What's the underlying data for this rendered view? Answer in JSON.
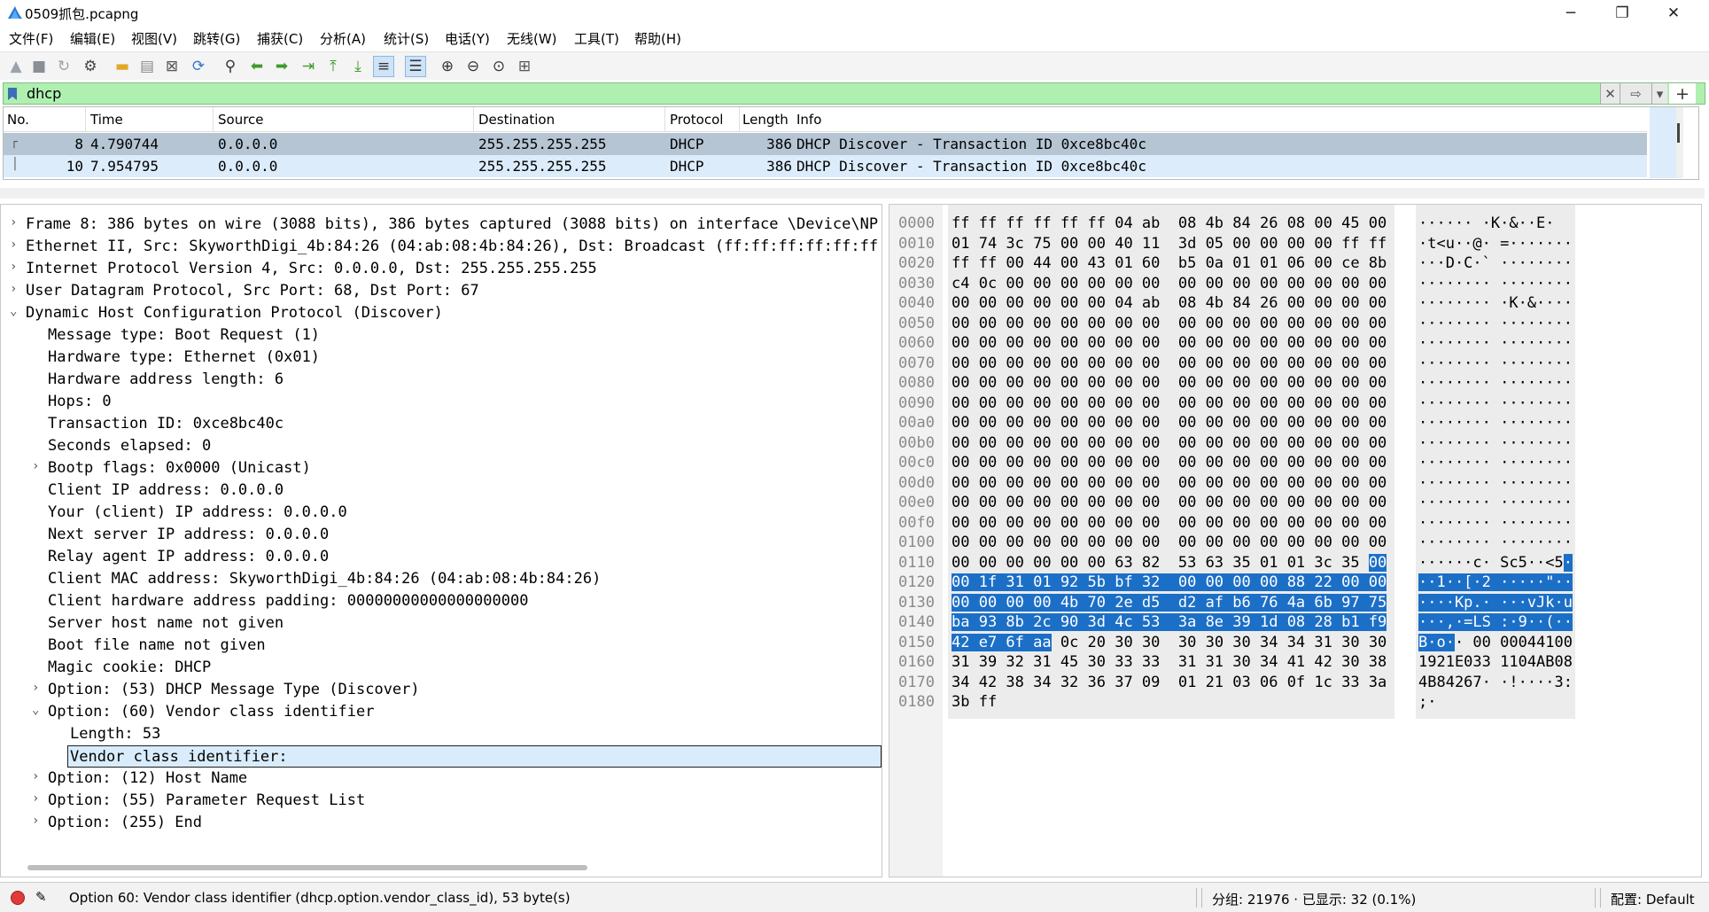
{
  "window": {
    "title": "0509抓包.pcapng",
    "min": "─",
    "max": "❐",
    "close": "✕"
  },
  "menu": [
    "文件(F)",
    "编辑(E)",
    "视图(V)",
    "跳转(G)",
    "捕获(C)",
    "分析(A)",
    "统计(S)",
    "电话(Y)",
    "无线(W)",
    "工具(T)",
    "帮助(H)"
  ],
  "toolbar_icons": [
    "shark-fin-start-icon",
    "stop-icon",
    "restart-icon",
    "options-gear-icon",
    "open-folder-icon",
    "save-file-icon",
    "close-file-icon",
    "reload-icon",
    "find-packet-icon",
    "back-arrow-icon",
    "forward-arrow-icon",
    "go-to-packet-icon",
    "first-packet-icon",
    "last-packet-icon",
    "autoscroll-icon",
    "colorize-icon",
    "zoom-in-icon",
    "zoom-out-icon",
    "zoom-reset-icon",
    "resize-columns-icon"
  ],
  "filter": {
    "value": "dhcp",
    "clear": "✕",
    "apply": "⇨",
    "dropdown": "▾",
    "add": "+"
  },
  "packet_list": {
    "headers": [
      "No.",
      "Time",
      "Source",
      "Destination",
      "Protocol",
      "Length",
      "Info"
    ],
    "rows": [
      {
        "no": "8",
        "time": "4.790744",
        "src": "0.0.0.0",
        "dst": "255.255.255.255",
        "proto": "DHCP",
        "len": "386",
        "info": "DHCP Discover - Transaction ID 0xce8bc40c"
      },
      {
        "no": "10",
        "time": "7.954795",
        "src": "0.0.0.0",
        "dst": "255.255.255.255",
        "proto": "DHCP",
        "len": "386",
        "info": "DHCP Discover - Transaction ID 0xce8bc40c"
      }
    ]
  },
  "detail": [
    {
      "arrow": ">",
      "indent": 0,
      "text": "Frame 8: 386 bytes on wire (3088 bits), 386 bytes captured (3088 bits) on interface \\Device\\NP"
    },
    {
      "arrow": ">",
      "indent": 0,
      "text": "Ethernet II, Src: SkyworthDigi_4b:84:26 (04:ab:08:4b:84:26), Dst: Broadcast (ff:ff:ff:ff:ff:ff"
    },
    {
      "arrow": ">",
      "indent": 0,
      "text": "Internet Protocol Version 4, Src: 0.0.0.0, Dst: 255.255.255.255"
    },
    {
      "arrow": ">",
      "indent": 0,
      "text": "User Datagram Protocol, Src Port: 68, Dst Port: 67"
    },
    {
      "arrow": "v",
      "indent": 0,
      "text": "Dynamic Host Configuration Protocol (Discover)"
    },
    {
      "arrow": "",
      "indent": 1,
      "text": "Message type: Boot Request (1)"
    },
    {
      "arrow": "",
      "indent": 1,
      "text": "Hardware type: Ethernet (0x01)"
    },
    {
      "arrow": "",
      "indent": 1,
      "text": "Hardware address length: 6"
    },
    {
      "arrow": "",
      "indent": 1,
      "text": "Hops: 0"
    },
    {
      "arrow": "",
      "indent": 1,
      "text": "Transaction ID: 0xce8bc40c"
    },
    {
      "arrow": "",
      "indent": 1,
      "text": "Seconds elapsed: 0"
    },
    {
      "arrow": ">",
      "indent": 1,
      "text": "Bootp flags: 0x0000 (Unicast)"
    },
    {
      "arrow": "",
      "indent": 1,
      "text": "Client IP address: 0.0.0.0"
    },
    {
      "arrow": "",
      "indent": 1,
      "text": "Your (client) IP address: 0.0.0.0"
    },
    {
      "arrow": "",
      "indent": 1,
      "text": "Next server IP address: 0.0.0.0"
    },
    {
      "arrow": "",
      "indent": 1,
      "text": "Relay agent IP address: 0.0.0.0"
    },
    {
      "arrow": "",
      "indent": 1,
      "text": "Client MAC address: SkyworthDigi_4b:84:26 (04:ab:08:4b:84:26)"
    },
    {
      "arrow": "",
      "indent": 1,
      "text": "Client hardware address padding: 00000000000000000000"
    },
    {
      "arrow": "",
      "indent": 1,
      "text": "Server host name not given"
    },
    {
      "arrow": "",
      "indent": 1,
      "text": "Boot file name not given"
    },
    {
      "arrow": "",
      "indent": 1,
      "text": "Magic cookie: DHCP"
    },
    {
      "arrow": ">",
      "indent": 1,
      "text": "Option: (53) DHCP Message Type (Discover)"
    },
    {
      "arrow": "v",
      "indent": 1,
      "text": "Option: (60) Vendor class identifier"
    },
    {
      "arrow": "",
      "indent": 2,
      "text": "Length: 53"
    },
    {
      "arrow": "",
      "indent": 2,
      "text": "Vendor class identifier: ",
      "selected": true
    },
    {
      "arrow": ">",
      "indent": 1,
      "text": "Option: (12) Host Name"
    },
    {
      "arrow": ">",
      "indent": 1,
      "text": "Option: (55) Parameter Request List"
    },
    {
      "arrow": ">",
      "indent": 1,
      "text": "Option: (255) End"
    }
  ],
  "bytes": [
    {
      "off": "0000",
      "hex": "ff ff ff ff ff ff 04 ab  08 4b 84 26 08 00 45 00",
      "asc": "······ ·K·&··E·"
    },
    {
      "off": "0010",
      "hex": "01 74 3c 75 00 00 40 11  3d 05 00 00 00 00 ff ff",
      "asc": "·t<u··@· =·······"
    },
    {
      "off": "0020",
      "hex": "ff ff 00 44 00 43 01 60  b5 0a 01 01 06 00 ce 8b",
      "asc": "···D·C·` ········"
    },
    {
      "off": "0030",
      "hex": "c4 0c 00 00 00 00 00 00  00 00 00 00 00 00 00 00",
      "asc": "········ ········"
    },
    {
      "off": "0040",
      "hex": "00 00 00 00 00 00 04 ab  08 4b 84 26 00 00 00 00",
      "asc": "········ ·K·&····"
    },
    {
      "off": "0050",
      "hex": "00 00 00 00 00 00 00 00  00 00 00 00 00 00 00 00",
      "asc": "········ ········"
    },
    {
      "off": "0060",
      "hex": "00 00 00 00 00 00 00 00  00 00 00 00 00 00 00 00",
      "asc": "········ ········"
    },
    {
      "off": "0070",
      "hex": "00 00 00 00 00 00 00 00  00 00 00 00 00 00 00 00",
      "asc": "········ ········"
    },
    {
      "off": "0080",
      "hex": "00 00 00 00 00 00 00 00  00 00 00 00 00 00 00 00",
      "asc": "········ ········"
    },
    {
      "off": "0090",
      "hex": "00 00 00 00 00 00 00 00  00 00 00 00 00 00 00 00",
      "asc": "········ ········"
    },
    {
      "off": "00a0",
      "hex": "00 00 00 00 00 00 00 00  00 00 00 00 00 00 00 00",
      "asc": "········ ········"
    },
    {
      "off": "00b0",
      "hex": "00 00 00 00 00 00 00 00  00 00 00 00 00 00 00 00",
      "asc": "········ ········"
    },
    {
      "off": "00c0",
      "hex": "00 00 00 00 00 00 00 00  00 00 00 00 00 00 00 00",
      "asc": "········ ········"
    },
    {
      "off": "00d0",
      "hex": "00 00 00 00 00 00 00 00  00 00 00 00 00 00 00 00",
      "asc": "········ ········"
    },
    {
      "off": "00e0",
      "hex": "00 00 00 00 00 00 00 00  00 00 00 00 00 00 00 00",
      "asc": "········ ········"
    },
    {
      "off": "00f0",
      "hex": "00 00 00 00 00 00 00 00  00 00 00 00 00 00 00 00",
      "asc": "········ ········"
    },
    {
      "off": "0100",
      "hex": "00 00 00 00 00 00 00 00  00 00 00 00 00 00 00 00",
      "asc": "········ ········"
    },
    {
      "off": "0110",
      "hex": "00 00 00 00 00 00 63 82  53 63 35 01 01 3c 35 ",
      "hexhl": "00",
      "asc": "······c· Sc5··<5",
      "aschl": "·"
    },
    {
      "off": "0120",
      "hexhl": "00 1f 31 01 92 5b bf 32  00 00 00 00 88 22 00 00",
      "aschl": "··1··[·2 ·····\"··"
    },
    {
      "off": "0130",
      "hexhl": "00 00 00 00 4b 70 2e d5  d2 af b6 76 4a 6b 97 75",
      "aschl": "····Kp.· ···vJk·u"
    },
    {
      "off": "0140",
      "hexhl": "ba 93 8b 2c 90 3d 4c 53  3a 8e 39 1d 08 28 b1 f9",
      "aschl": "···,·=LS :·9··(··"
    },
    {
      "off": "0150",
      "hexhl": "42 e7 6f aa",
      "hex": " 0c 20 30 30  30 30 30 34 34 31 30 30",
      "aschl": "B·o·",
      "asc": "· 00 00044100"
    },
    {
      "off": "0160",
      "hex": "31 39 32 31 45 30 33 33  31 31 30 34 41 42 30 38",
      "asc": "1921E033 1104AB08"
    },
    {
      "off": "0170",
      "hex": "34 42 38 34 32 36 37 09  01 21 03 06 0f 1c 33 3a",
      "asc": "4B84267· ·!····3:"
    },
    {
      "off": "0180",
      "hex": "3b ff",
      "asc": ";·"
    }
  ],
  "status": {
    "message": "Option 60: Vendor class identifier (dhcp.option.vendor_class_id), 53 byte(s)",
    "packets": "分组: 21976 · 已显示: 32 (0.1%)",
    "profile": "配置: Default"
  }
}
